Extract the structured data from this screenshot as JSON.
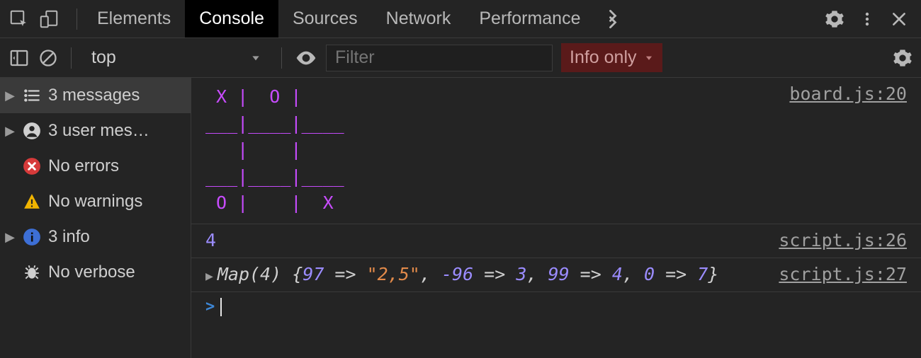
{
  "tabs": {
    "elements": "Elements",
    "console": "Console",
    "sources": "Sources",
    "network": "Network",
    "performance": "Performance"
  },
  "toolbar": {
    "context": "top",
    "filter_placeholder": "Filter",
    "level": "Info only"
  },
  "sidebar": {
    "messages": "3 messages",
    "user_messages": "3 user mes…",
    "errors": "No errors",
    "warnings": "No warnings",
    "info": "3 info",
    "verbose": "No verbose"
  },
  "console": {
    "board_src": "board.js:20",
    "board_lines": [
      " X |  O | ",
      "___|____|____",
      "   |    | ",
      "___|____|____",
      " O |    |  X"
    ],
    "value_num": "4",
    "value_src": "script.js:26",
    "map_label": "Map(4)",
    "map_src": "script.js:27",
    "map_entries": [
      {
        "k": "97",
        "v": "\"2,5\"",
        "vtype": "str"
      },
      {
        "k": "-96",
        "v": "3",
        "vtype": "num"
      },
      {
        "k": "99",
        "v": "4",
        "vtype": "num"
      },
      {
        "k": "0",
        "v": "7",
        "vtype": "num"
      }
    ],
    "prompt": ">"
  }
}
